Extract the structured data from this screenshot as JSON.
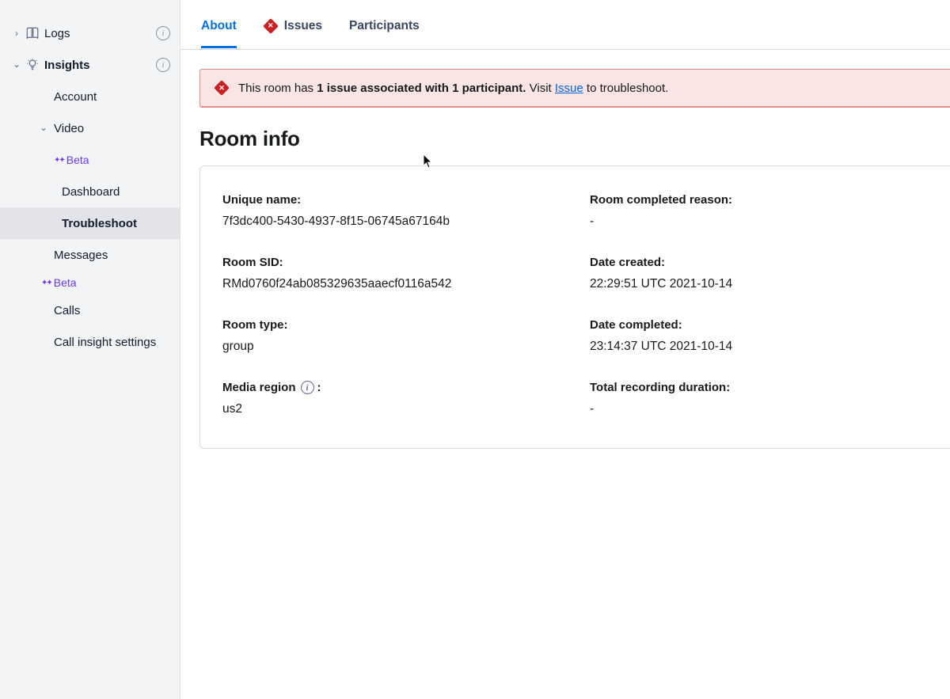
{
  "sidebar": {
    "logs": {
      "label": "Logs"
    },
    "insights": {
      "label": "Insights"
    },
    "insights_children": {
      "account": "Account",
      "video": "Video",
      "video_children": {
        "beta": "Beta",
        "dashboard": "Dashboard",
        "troubleshoot": "Troubleshoot"
      },
      "messages": "Messages",
      "beta": "Beta",
      "calls": "Calls",
      "call_insight_settings": "Call insight settings"
    }
  },
  "tabs": {
    "about": "About",
    "issues": "Issues",
    "participants": "Participants"
  },
  "alert": {
    "prefix": "This room has ",
    "bold": "1 issue associated with 1 participant.",
    "mid": " Visit ",
    "link": "Issue",
    "suffix": " to troubleshoot."
  },
  "section_title": "Room info",
  "room": {
    "unique_name": {
      "label": "Unique name:",
      "value": "7f3dc400-5430-4937-8f15-06745a67164b"
    },
    "room_sid": {
      "label": "Room SID:",
      "value": "RMd0760f24ab085329635aaecf0116a542"
    },
    "room_type": {
      "label": "Room type:",
      "value": "group"
    },
    "media_region": {
      "label": "Media region",
      "value": "us2"
    },
    "completed_reason": {
      "label": "Room completed reason:",
      "value": "-"
    },
    "date_created": {
      "label": "Date created:",
      "value": "22:29:51 UTC 2021-10-14"
    },
    "date_completed": {
      "label": "Date completed:",
      "value": "23:14:37 UTC 2021-10-14"
    },
    "total_recording": {
      "label": "Total recording duration:",
      "value": "-"
    }
  }
}
